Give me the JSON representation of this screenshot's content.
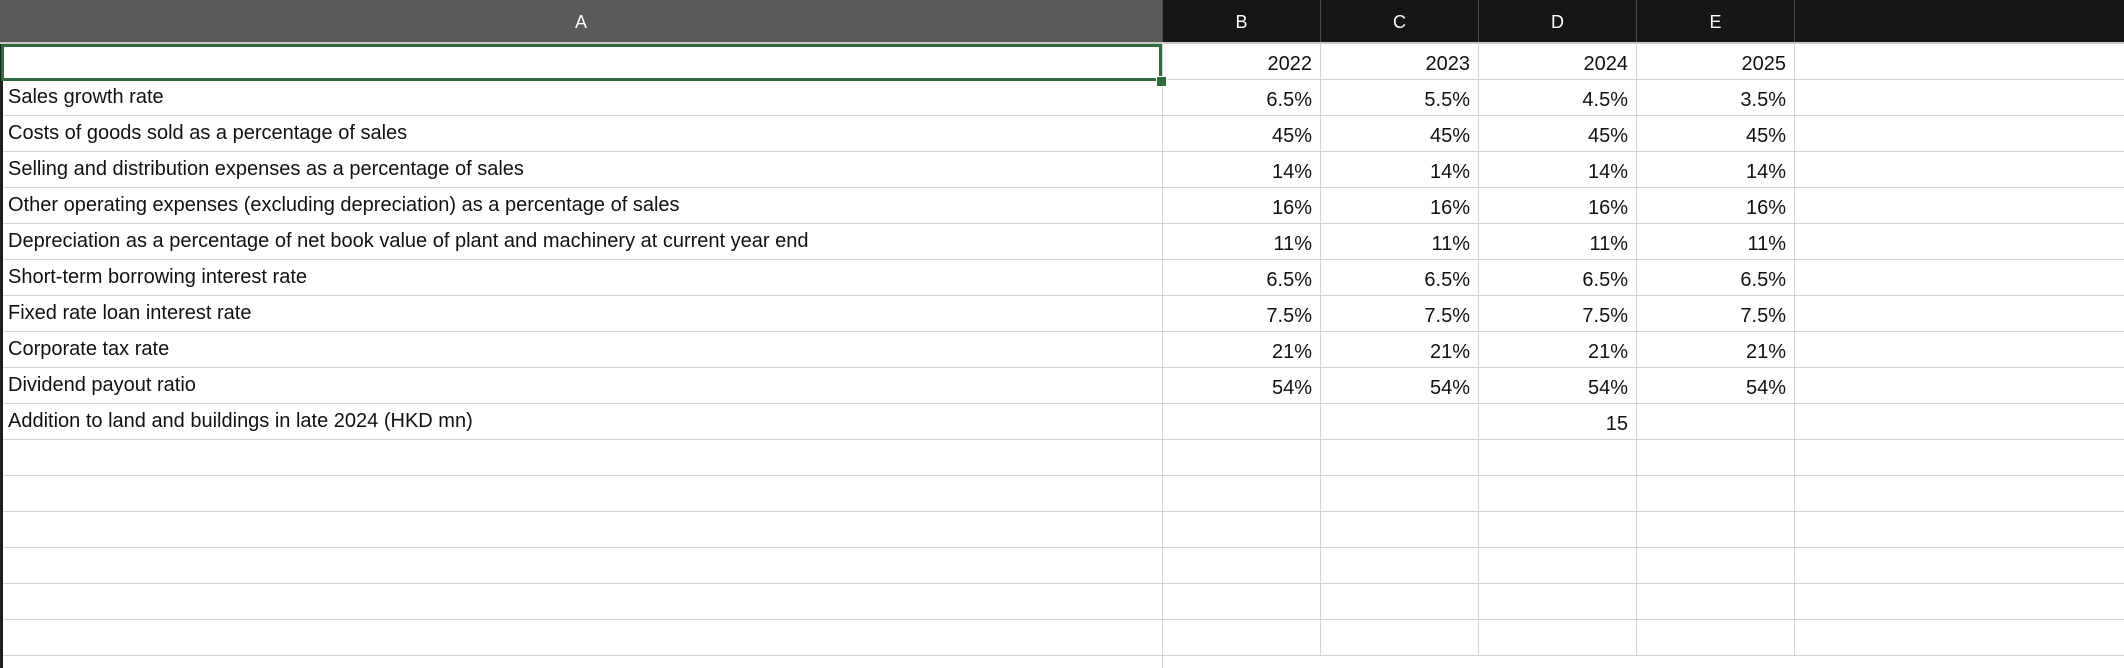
{
  "columns": [
    "A",
    "B",
    "C",
    "D",
    "E"
  ],
  "header_row": {
    "a": "",
    "b": "2022",
    "c": "2023",
    "d": "2024",
    "e": "2025"
  },
  "rows": [
    {
      "a": "Sales growth rate",
      "b": "6.5%",
      "c": "5.5%",
      "d": "4.5%",
      "e": "3.5%"
    },
    {
      "a": "Costs of goods sold as a percentage of sales",
      "b": "45%",
      "c": "45%",
      "d": "45%",
      "e": "45%"
    },
    {
      "a": "Selling and distribution expenses as a percentage of sales",
      "b": "14%",
      "c": "14%",
      "d": "14%",
      "e": "14%"
    },
    {
      "a": "Other operating expenses (excluding depreciation) as a percentage of sales",
      "b": "16%",
      "c": "16%",
      "d": "16%",
      "e": "16%"
    },
    {
      "a": "Depreciation as a percentage of net book value of plant and machinery at current year end",
      "b": "11%",
      "c": "11%",
      "d": "11%",
      "e": "11%"
    },
    {
      "a": "Short-term borrowing interest rate",
      "b": "6.5%",
      "c": "6.5%",
      "d": "6.5%",
      "e": "6.5%"
    },
    {
      "a": "Fixed rate loan interest rate",
      "b": "7.5%",
      "c": "7.5%",
      "d": "7.5%",
      "e": "7.5%"
    },
    {
      "a": "Corporate tax rate",
      "b": "21%",
      "c": "21%",
      "d": "21%",
      "e": "21%"
    },
    {
      "a": "Dividend payout ratio",
      "b": "54%",
      "c": "54%",
      "d": "54%",
      "e": "54%"
    },
    {
      "a": "Addition to land and buildings in late 2024 (HKD mn)",
      "b": "",
      "c": "",
      "d": "15",
      "e": ""
    },
    {
      "a": "",
      "b": "",
      "c": "",
      "d": "",
      "e": ""
    },
    {
      "a": "",
      "b": "",
      "c": "",
      "d": "",
      "e": ""
    },
    {
      "a": "",
      "b": "",
      "c": "",
      "d": "",
      "e": ""
    },
    {
      "a": "",
      "b": "",
      "c": "",
      "d": "",
      "e": ""
    },
    {
      "a": "",
      "b": "",
      "c": "",
      "d": "",
      "e": ""
    },
    {
      "a": "",
      "b": "",
      "c": "",
      "d": "",
      "e": ""
    }
  ]
}
